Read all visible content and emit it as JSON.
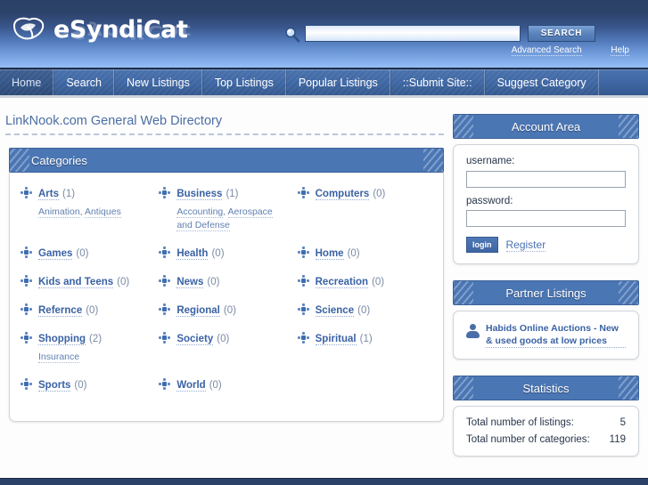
{
  "header": {
    "logo_text": "eSyndiCat",
    "logo_icon": "leaf-mark-icon",
    "search": {
      "icon": "search-icon",
      "value": "",
      "placeholder": "",
      "button_label": "SEARCH"
    },
    "links": [
      {
        "label": "Advanced Search"
      },
      {
        "label": "Help"
      }
    ]
  },
  "nav": {
    "items": [
      {
        "label": "Home",
        "active": true
      },
      {
        "label": "Search",
        "active": false
      },
      {
        "label": "New Listings",
        "active": false
      },
      {
        "label": "Top Listings",
        "active": false
      },
      {
        "label": "Popular Listings",
        "active": false
      },
      {
        "label": "::Submit Site::",
        "active": false
      },
      {
        "label": "Suggest Category",
        "active": false
      }
    ]
  },
  "main": {
    "page_title": "LinkNook.com General Web Directory",
    "categories_panel_title": "Categories",
    "categories": [
      {
        "name": "Arts",
        "count": "(1)",
        "subcats": [
          "Animation",
          "Antiques"
        ]
      },
      {
        "name": "Business",
        "count": "(1)",
        "subcats": [
          "Accounting",
          "Aerospace and Defense"
        ]
      },
      {
        "name": "Computers",
        "count": "(0)",
        "subcats": []
      },
      {
        "name": "Games",
        "count": "(0)",
        "subcats": []
      },
      {
        "name": "Health",
        "count": "(0)",
        "subcats": []
      },
      {
        "name": "Home",
        "count": "(0)",
        "subcats": []
      },
      {
        "name": "Kids and Teens",
        "count": "(0)",
        "subcats": []
      },
      {
        "name": "News",
        "count": "(0)",
        "subcats": []
      },
      {
        "name": "Recreation",
        "count": "(0)",
        "subcats": []
      },
      {
        "name": "Refernce",
        "count": "(0)",
        "subcats": []
      },
      {
        "name": "Regional",
        "count": "(0)",
        "subcats": []
      },
      {
        "name": "Science",
        "count": "(0)",
        "subcats": []
      },
      {
        "name": "Shopping",
        "count": "(2)",
        "subcats": [
          "Insurance"
        ]
      },
      {
        "name": "Society",
        "count": "(0)",
        "subcats": []
      },
      {
        "name": "Spiritual",
        "count": "(1)",
        "subcats": []
      },
      {
        "name": "Sports",
        "count": "(0)",
        "subcats": []
      },
      {
        "name": "World",
        "count": "(0)",
        "subcats": []
      }
    ]
  },
  "sidebar": {
    "account": {
      "title": "Account Area",
      "username_label": "username:",
      "username_value": "",
      "password_label": "password:",
      "password_value": "",
      "login_label": "login",
      "register_label": "Register"
    },
    "partners": {
      "title": "Partner Listings",
      "icon": "user-icon",
      "items": [
        {
          "label": "Habids Online Auctions - New & used goods at low prices"
        }
      ]
    },
    "statistics": {
      "title": "Statistics",
      "rows": [
        {
          "label": "Total number of listings:",
          "value": "5"
        },
        {
          "label": "Total number of categories:",
          "value": "119"
        }
      ]
    }
  },
  "colors": {
    "header_dark": "#2b4168",
    "header_light": "#9cc2f5",
    "nav_blue": "#3f67a3",
    "panel_blue": "#4b76b4",
    "link_blue": "#3a62a4",
    "title_blue": "#4a6ea3"
  }
}
